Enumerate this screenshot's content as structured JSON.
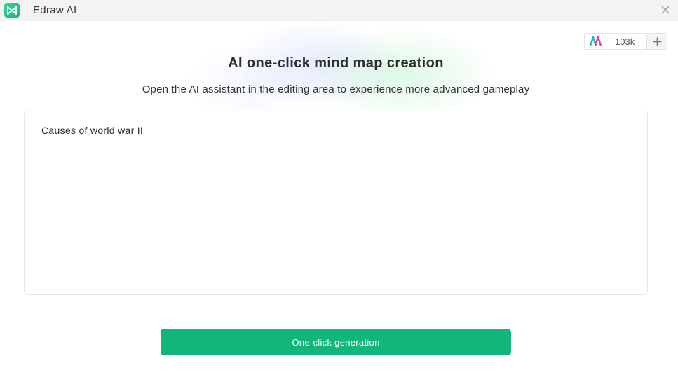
{
  "window": {
    "title": "Edraw AI",
    "logo_icon": "edraw-logo-icon",
    "close_icon": "close-icon"
  },
  "credits": {
    "icon": "ai-credits-icon",
    "count": "103k",
    "add_icon": "plus-icon"
  },
  "main": {
    "heading": "AI one-click mind map creation",
    "subheading": "Open the AI assistant in the editing area to experience more advanced gameplay",
    "prompt_value": "Causes of world war II",
    "generate_label": "One-click generation"
  },
  "colors": {
    "accent": "#10b67a",
    "titlebar_bg": "#f3f3f3"
  }
}
